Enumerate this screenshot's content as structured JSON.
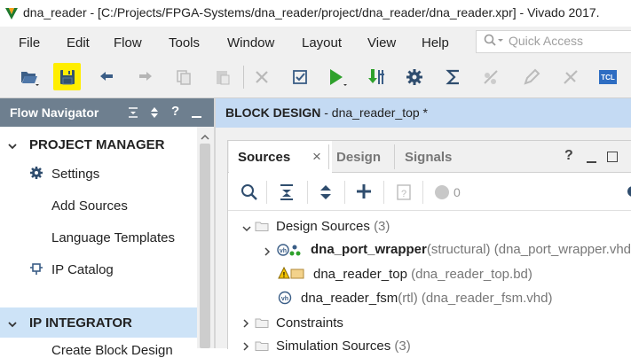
{
  "window": {
    "title": "dna_reader - [C:/Projects/FPGA-Systems/dna_reader/project/dna_reader/dna_reader.xpr] - Vivado 2017."
  },
  "menu": {
    "items": [
      "File",
      "Edit",
      "Flow",
      "Tools",
      "Window",
      "Layout",
      "View",
      "Help"
    ],
    "quick_access_placeholder": "Quick Access"
  },
  "toolbar": {
    "icons": [
      "open-project-icon",
      "save-icon",
      "undo-icon",
      "redo-icon",
      "copy-icon",
      "paste-icon",
      "delete-icon",
      "validate-icon",
      "run-icon",
      "program-icon",
      "settings-icon",
      "sigma-icon",
      "auto-connect-icon",
      "edit-icon",
      "cancel-icon",
      "tcl-icon"
    ],
    "tcl_label": "TCL",
    "highlight_color": "#ffee00"
  },
  "flow_navigator": {
    "title": "Flow Navigator",
    "sections": [
      {
        "label": "PROJECT MANAGER",
        "items": [
          "Settings",
          "Add Sources",
          "Language Templates",
          "IP Catalog"
        ]
      },
      {
        "label": "IP INTEGRATOR",
        "items": [
          "Create Block Design"
        ]
      }
    ]
  },
  "block_design": {
    "label": "BLOCK DESIGN",
    "name": "dna_reader_top *"
  },
  "sources_panel": {
    "tabs": [
      "Sources",
      "Design",
      "Signals"
    ],
    "active_tab": "Sources",
    "badge_count": "0",
    "tree": {
      "design_sources": {
        "label": "Design Sources",
        "count": "(3)"
      },
      "items": [
        {
          "name": "dna_port_wrapper",
          "type": "(structural)",
          "file": "(dna_port_wrapper.vhd)"
        },
        {
          "name": "dna_reader_top",
          "type": "",
          "file": "(dna_reader_top.bd)"
        },
        {
          "name": "dna_reader_fsm",
          "type": "(rtl)",
          "file": "(dna_reader_fsm.vhd)"
        }
      ],
      "constraints": {
        "label": "Constraints"
      },
      "simulation_sources": {
        "label": "Simulation Sources",
        "count": "(3)"
      }
    }
  }
}
